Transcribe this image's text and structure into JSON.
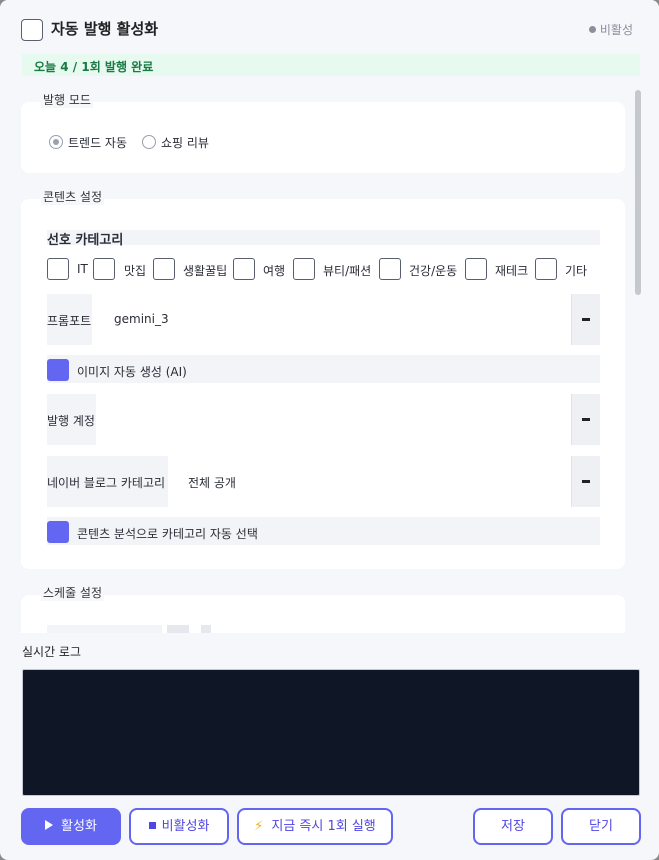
{
  "header": {
    "title": "자동 발행 활성화",
    "status": "비활성"
  },
  "today_banner": "오늘  4 / 1회 발행 완료",
  "publish_mode": {
    "legend": "발행 모드",
    "options": [
      {
        "label": "트렌드 자동",
        "selected": true
      },
      {
        "label": "쇼핑 리뷰",
        "selected": false
      }
    ]
  },
  "content_settings": {
    "legend": "콘텐츠 설정",
    "category_title": "선호 카테고리",
    "categories": [
      "IT",
      "맛집",
      "생활꿀팁",
      "여행",
      "뷰티/패션",
      "건강/운동",
      "재테크",
      "기타"
    ],
    "prompt_label": "프롬포트",
    "prompt_value": "gemini_3",
    "auto_image_label": "이미지 자동 생성 (AI)",
    "account_label": "발행 계정",
    "account_value": "",
    "naver_category_label": "네이버 블로그 카테고리",
    "naver_category_value": "전체 공개",
    "auto_category_label": "콘텐츠 분석으로 카테고리 자동 선택"
  },
  "schedule": {
    "legend": "스케줄 설정"
  },
  "log": {
    "title": "실시간 로그"
  },
  "footer": {
    "activate": "활성화",
    "deactivate": "비활성화",
    "run_now": "지금 즉시 1회 실행",
    "save": "저장",
    "close": "닫기"
  },
  "colors": {
    "accent": "#6366f1",
    "banner_bg": "#e6faf0",
    "banner_text": "#1b7a43",
    "log_bg": "#0f1626"
  }
}
